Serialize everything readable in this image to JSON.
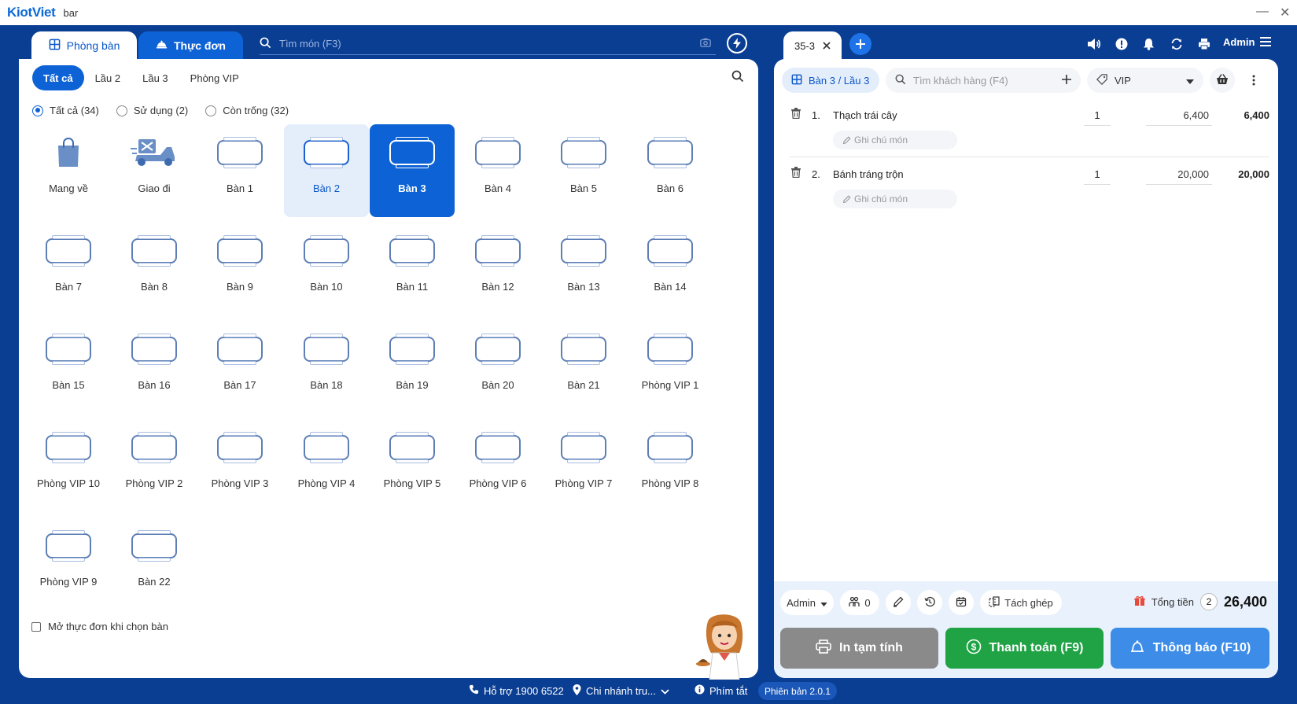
{
  "app": {
    "logo_text": "KiotViet",
    "window_title": "bar",
    "minimize_glyph": "—",
    "close_glyph": "✕"
  },
  "left_tabs": {
    "tables_label": "Phòng bàn",
    "menu_label": "Thực đơn"
  },
  "search": {
    "placeholder": "Tìm món (F3)"
  },
  "floor_tabs": [
    "Tất cả",
    "Lầu 2",
    "Lầu 3",
    "Phòng VIP"
  ],
  "filters": [
    {
      "label": "Tất cả (34)",
      "selected": true
    },
    {
      "label": "Sử dụng (2)",
      "selected": false
    },
    {
      "label": "Còn trống (32)",
      "selected": false
    }
  ],
  "tables": [
    {
      "label": "Mang về",
      "icon": "shopping-bag-icon",
      "state": "normal"
    },
    {
      "label": "Giao đi",
      "icon": "delivery-scooter-icon",
      "state": "normal"
    },
    {
      "label": "Bàn 1",
      "icon": "table-icon",
      "state": "normal"
    },
    {
      "label": "Bàn 2",
      "icon": "table-icon",
      "state": "in-use"
    },
    {
      "label": "Bàn 3",
      "icon": "table-icon",
      "state": "selected"
    },
    {
      "label": "Bàn 4",
      "icon": "table-icon",
      "state": "normal"
    },
    {
      "label": "Bàn 5",
      "icon": "table-icon",
      "state": "normal"
    },
    {
      "label": "Bàn 6",
      "icon": "table-icon",
      "state": "normal"
    },
    {
      "label": "Bàn 7",
      "icon": "table-icon",
      "state": "normal"
    },
    {
      "label": "Bàn 8",
      "icon": "table-icon",
      "state": "normal"
    },
    {
      "label": "Bàn 9",
      "icon": "table-icon",
      "state": "normal"
    },
    {
      "label": "Bàn 10",
      "icon": "table-icon",
      "state": "normal"
    },
    {
      "label": "Bàn 11",
      "icon": "table-icon",
      "state": "normal"
    },
    {
      "label": "Bàn 12",
      "icon": "table-icon",
      "state": "normal"
    },
    {
      "label": "Bàn 13",
      "icon": "table-icon",
      "state": "normal"
    },
    {
      "label": "Bàn 14",
      "icon": "table-icon",
      "state": "normal"
    },
    {
      "label": "Bàn 15",
      "icon": "table-icon",
      "state": "normal"
    },
    {
      "label": "Bàn 16",
      "icon": "table-icon",
      "state": "normal"
    },
    {
      "label": "Bàn 17",
      "icon": "table-icon",
      "state": "normal"
    },
    {
      "label": "Bàn 18",
      "icon": "table-icon",
      "state": "normal"
    },
    {
      "label": "Bàn 19",
      "icon": "table-icon",
      "state": "normal"
    },
    {
      "label": "Bàn 20",
      "icon": "table-icon",
      "state": "normal"
    },
    {
      "label": "Bàn 21",
      "icon": "table-icon",
      "state": "normal"
    },
    {
      "label": "Phòng VIP 1",
      "icon": "table-icon",
      "state": "normal"
    },
    {
      "label": "Phòng VIP 10",
      "icon": "table-icon",
      "state": "normal"
    },
    {
      "label": "Phòng VIP 2",
      "icon": "table-icon",
      "state": "normal"
    },
    {
      "label": "Phòng VIP 3",
      "icon": "table-icon",
      "state": "normal"
    },
    {
      "label": "Phòng VIP 4",
      "icon": "table-icon",
      "state": "normal"
    },
    {
      "label": "Phòng VIP 5",
      "icon": "table-icon",
      "state": "normal"
    },
    {
      "label": "Phòng VIP 6",
      "icon": "table-icon",
      "state": "normal"
    },
    {
      "label": "Phòng VIP 7",
      "icon": "table-icon",
      "state": "normal"
    },
    {
      "label": "Phòng VIP 8",
      "icon": "table-icon",
      "state": "normal"
    },
    {
      "label": "Phòng VIP 9",
      "icon": "table-icon",
      "state": "normal"
    },
    {
      "label": "Bàn 22",
      "icon": "table-icon",
      "state": "normal"
    }
  ],
  "open_menu_checkbox": {
    "label": "Mở thực đơn khi chọn bàn",
    "checked": false
  },
  "order_tab": {
    "label": "35-3"
  },
  "header_user": "Admin",
  "order": {
    "table_pill": "Bàn 3 / Lầu 3",
    "customer_placeholder": "Tìm khách hàng (F4)",
    "price_list": "VIP",
    "note_placeholder": "Ghi chú món",
    "items": [
      {
        "index": "1.",
        "name": "Thạch trái cây",
        "qty": "1",
        "price": "6,400",
        "total": "6,400"
      },
      {
        "index": "2.",
        "name": "Bánh tráng trộn",
        "qty": "1",
        "price": "20,000",
        "total": "20,000"
      }
    ]
  },
  "footer": {
    "staff": "Admin",
    "guests": "0",
    "split_merge": "Tách ghép",
    "total_label": "Tổng tiền",
    "item_count": "2",
    "total_value": "26,400",
    "btn_print": "In tạm tính",
    "btn_pay": "Thanh toán (F9)",
    "btn_notify": "Thông báo (F10)"
  },
  "statusbar": {
    "support": "Hỗ trợ 1900 6522",
    "branch": "Chi nhánh tru...",
    "shortcuts": "Phím tắt",
    "version": "Phiên bản 2.0.1"
  },
  "colors": {
    "brand_blue": "#0d63d6",
    "background": "#0a3e93",
    "pay_green": "#1fa344",
    "notify_blue": "#3d8de8",
    "print_gray": "#8a8a8a"
  }
}
